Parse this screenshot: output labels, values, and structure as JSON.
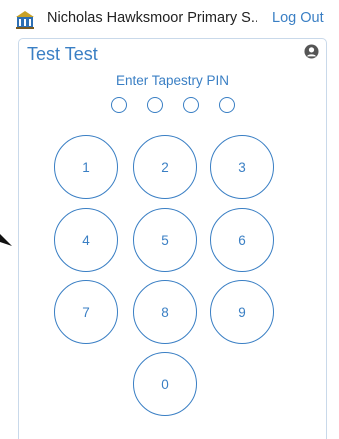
{
  "header": {
    "school_name": "Nicholas Hawksmoor Primary S...",
    "logout_label": "Log Out",
    "logo_icon": "school-building-icon"
  },
  "panel": {
    "user_name": "Test Test",
    "user_icon": "user-silhouette-icon",
    "pin_prompt": "Enter Tapestry PIN",
    "pin_digits_entered": 0,
    "pin_length": 4
  },
  "keypad": {
    "keys": [
      "1",
      "2",
      "3",
      "4",
      "5",
      "6",
      "7",
      "8",
      "9",
      "0"
    ]
  },
  "colors": {
    "accent": "#3a7fc4",
    "panel_border": "#c9d9ea",
    "text": "#222222"
  }
}
